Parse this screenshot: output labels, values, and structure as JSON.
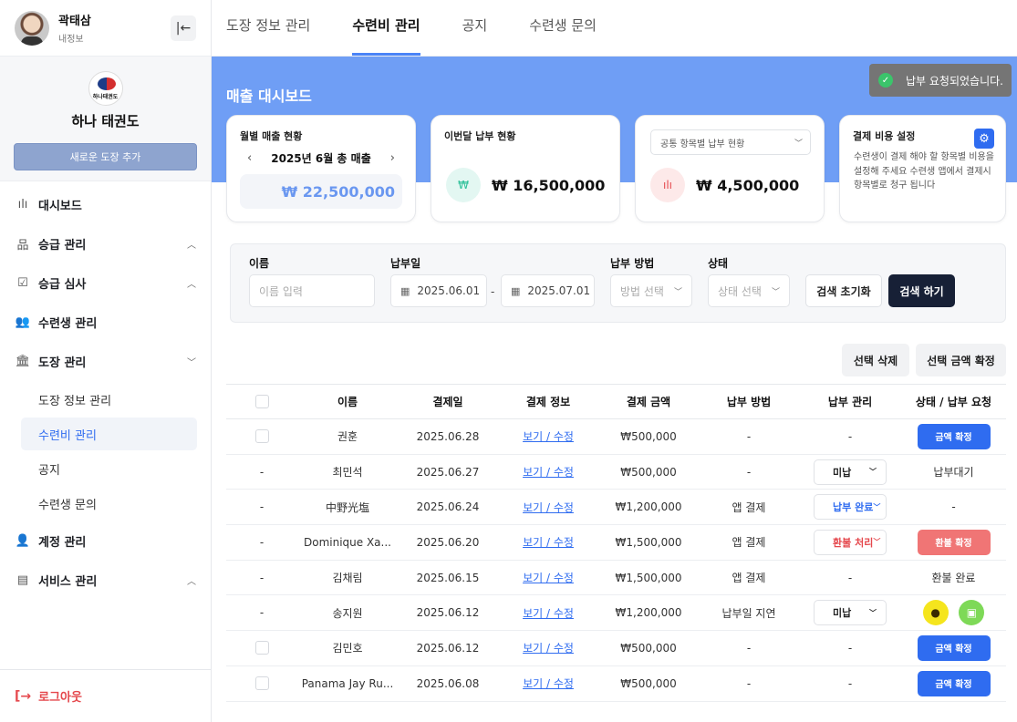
{
  "user": {
    "name": "곽태삼",
    "sub": "내정보"
  },
  "dojo": {
    "logo_text": "하나태권도",
    "name": "하나 태권도",
    "add_label": "새로운 도장 추가"
  },
  "nav": {
    "dashboard": "대시보드",
    "promotion": "승급 관리",
    "review": "승급 심사",
    "students": "수련생 관리",
    "dojo": "도장 관리",
    "sub": [
      "도장 정보 관리",
      "수련비 관리",
      "공지",
      "수련생 문의"
    ],
    "account": "계정 관리",
    "service": "서비스 관리",
    "logout": "로그아웃"
  },
  "tabs": [
    "도장 정보 관리",
    "수련비 관리",
    "공지",
    "수련생 문의"
  ],
  "banner_title": "매출 대시보드",
  "toast": "납부 요청되었습니다.",
  "cards": {
    "monthly": {
      "title": "월별 매출 현황",
      "month": "2025년 6월 총 매출",
      "total": "₩ 22,500,000"
    },
    "this_month": {
      "title": "이번달 납부 현황",
      "value": "₩ 16,500,000"
    },
    "common": {
      "select": "공통 항목별 납부 현황",
      "value": "₩ 4,500,000"
    },
    "settings": {
      "title": "결제 비용 설정",
      "text": "수련생이 결제 해야 할 항목별 비용을 설정해 주세요 수련생 앱에서 결제시 항목별로 청구 됩니다"
    }
  },
  "filter": {
    "name_label": "이름",
    "name_placeholder": "이름 입력",
    "date_label": "납부일",
    "date_from": "2025.06.01",
    "date_to": "2025.07.01",
    "method_label": "납부 방법",
    "method_placeholder": "방법 선택",
    "status_label": "상태",
    "status_placeholder": "상태 선택",
    "reset": "검색 초기화",
    "search": "검색 하기"
  },
  "actions": {
    "delete": "선택 삭제",
    "confirm": "선택 금액 확정"
  },
  "table": {
    "headers": [
      "이름",
      "결제일",
      "결제 정보",
      "결제 금액",
      "납부 방법",
      "납부 관리",
      "상태 / 납부 요청"
    ],
    "link": "보기 / 수정",
    "rows": [
      {
        "sel": "",
        "name": "권훈",
        "date": "2025.06.28",
        "amount": "₩500,000",
        "method": "-",
        "manage": "-",
        "status": "금액 확정"
      },
      {
        "sel": "-",
        "name": "최민석",
        "date": "2025.06.27",
        "amount": "₩500,000",
        "method": "-",
        "manage": "미납",
        "status": "납부대기"
      },
      {
        "sel": "-",
        "name": "中野光塩",
        "date": "2025.06.24",
        "amount": "₩1,200,000",
        "method": "앱 결제",
        "manage": "납부 완료",
        "status": "-"
      },
      {
        "sel": "-",
        "name": "Dominique Xa...",
        "date": "2025.06.20",
        "amount": "₩1,500,000",
        "method": "앱 결제",
        "manage": "환불 처리",
        "status": "환불 확정"
      },
      {
        "sel": "-",
        "name": "김채림",
        "date": "2025.06.15",
        "amount": "₩1,500,000",
        "method": "앱 결제",
        "manage": "-",
        "status": "환불 완료"
      },
      {
        "sel": "-",
        "name": "송지원",
        "date": "2025.06.12",
        "amount": "₩1,200,000",
        "method": "납부일 지연",
        "manage": "미납",
        "status": ""
      },
      {
        "sel": "",
        "name": "김민호",
        "date": "2025.06.12",
        "amount": "₩500,000",
        "method": "-",
        "manage": "-",
        "status": "금액 확정"
      },
      {
        "sel": "",
        "name": "Panama Jay Ru...",
        "date": "2025.06.08",
        "amount": "₩500,000",
        "method": "-",
        "manage": "-",
        "status": "금액 확정"
      }
    ]
  }
}
